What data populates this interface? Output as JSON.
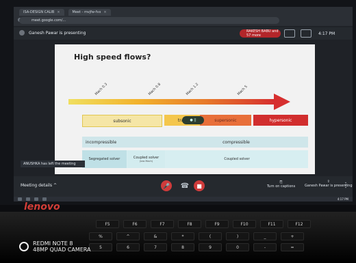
{
  "browser": {
    "tabs": [
      {
        "label": "ISA-DESIGN CALIB"
      },
      {
        "label": "Meet - mvjfw-fvx"
      }
    ],
    "address": "meet.google.com/..."
  },
  "meeting": {
    "presenter_text": "Ganesh Pawar is presenting",
    "attendee_pill": "RAKESH BABU and 57 more",
    "time": "4:17 PM",
    "toast": "ANUSHKA has left the meeting",
    "details_label": "Meeting details ^",
    "cc_label": "Turn on captions",
    "present_label": "Ganesh Pawar is presenting"
  },
  "slide": {
    "title": "High speed flows?",
    "mach_labels": [
      "Mach 0.3",
      "Mach 0.8",
      "Mach 1.2",
      "Mach 5"
    ],
    "bands": {
      "subsonic": "subsonic",
      "transonic": "tran",
      "supersonic": "supersonic",
      "hypersonic": "hypersonic"
    },
    "presenting_pill": "●  ||",
    "incompressible": "incompressible",
    "compressible": "compressible",
    "segregated_solver": "Segregated solver",
    "coupled_solver_short": "Coupled solver",
    "coupled_solver_tiny": "(low Mach)",
    "coupled_solver_long": "Coupled solver"
  },
  "taskbar": {
    "time": "4:17 PM"
  },
  "device": {
    "brand": "lenovo",
    "watermark_line1": "REDMI NOTE 8",
    "watermark_line2": "48MP QUAD CAMERA"
  },
  "keyboard": {
    "row1": [
      "F5",
      "F6",
      "F7",
      "F8",
      "F9",
      "F10",
      "F11",
      "F12"
    ],
    "row2": [
      "%",
      "^",
      "&",
      "*",
      "(",
      ")",
      "_",
      "+"
    ],
    "row3": [
      "5",
      "6",
      "7",
      "8",
      "9",
      "0",
      "-",
      "="
    ]
  },
  "colors": {
    "arrow_start": "#f0df60",
    "arrow_end": "#d62f2f",
    "meet_red": "#cf3b3b"
  }
}
